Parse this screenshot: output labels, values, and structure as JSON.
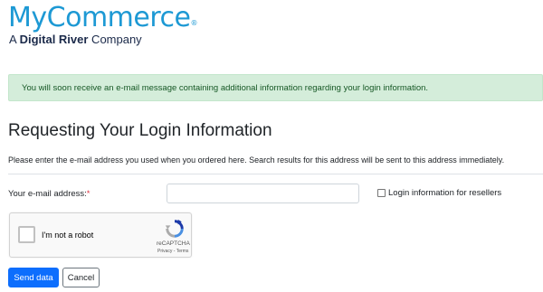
{
  "logo": {
    "name": "MyCommerce",
    "reg_mark": "®",
    "tagline_prefix": "A ",
    "tagline_brand": "Digital River",
    "tagline_suffix": " Company",
    "brand_color": "#1d99d4"
  },
  "alert": {
    "message": "You will soon receive an e-mail message containing additional information regarding your login information.",
    "bg_color": "#d4edda",
    "text_color": "#155724"
  },
  "page": {
    "title": "Requesting Your Login Information",
    "intro": "Please enter the e-mail address you used when you ordered here. Search results for this address will be sent to this address immediately."
  },
  "form": {
    "email_label": "Your e-mail address:",
    "required_mark": "*",
    "email_value": "",
    "reseller_label": "Login information for resellers",
    "reseller_checked": false
  },
  "captcha": {
    "label": "I'm not a robot",
    "brand": "reCAPTCHA",
    "links": "Privacy - Terms",
    "icon": "recaptcha-logo-icon"
  },
  "buttons": {
    "send_label": "Send data",
    "cancel_label": "Cancel",
    "primary_color": "#0d6efd"
  }
}
